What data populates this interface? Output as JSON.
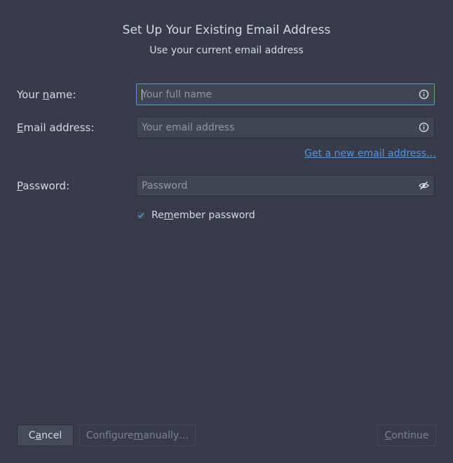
{
  "header": {
    "title": "Set Up Your Existing Email Address",
    "subtitle": "Use your current email address"
  },
  "form": {
    "name": {
      "label_pre": "Your ",
      "label_accel": "n",
      "label_post": "ame:",
      "placeholder": "Your full name",
      "value": "",
      "icon": "info-icon"
    },
    "email": {
      "label_pre": "",
      "label_accel": "E",
      "label_post": "mail address:",
      "placeholder": "Your email address",
      "value": "",
      "icon": "info-icon"
    },
    "new_email_link": "Get a new email address…",
    "password": {
      "label_pre": "",
      "label_accel": "P",
      "label_post": "assword:",
      "placeholder": "Password",
      "value": "",
      "icon": "eye-slash-icon"
    },
    "remember": {
      "label_pre": "Re",
      "label_accel": "m",
      "label_post": "ember password",
      "checked": true
    }
  },
  "buttons": {
    "cancel": {
      "pre": "C",
      "accel": "a",
      "post": "ncel"
    },
    "manual": {
      "pre": "Configure ",
      "accel": "m",
      "post": "anually…"
    },
    "continue": {
      "pre": "",
      "accel": "C",
      "post": "ontinue"
    }
  },
  "colors": {
    "background": "#383c4a",
    "field_bg": "#404552",
    "accent": "#5294e2",
    "text": "#d3dae3",
    "disabled_text": "#7c8290"
  }
}
